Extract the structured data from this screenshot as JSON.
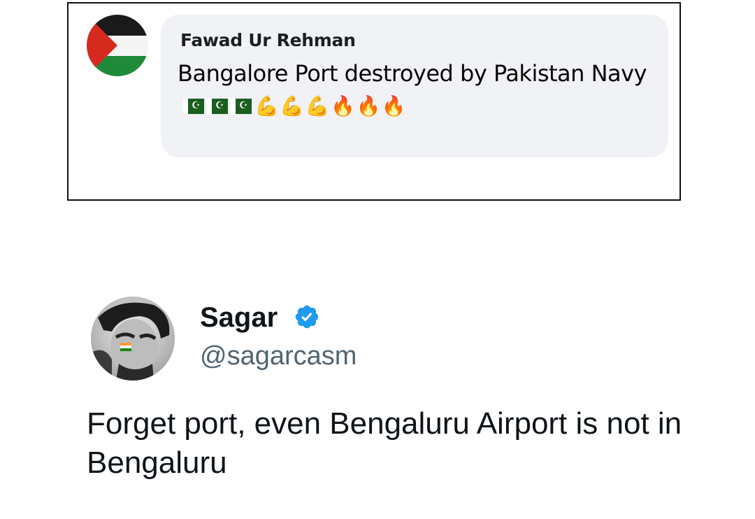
{
  "quoted_post": {
    "author_name": "Fawad Ur Rehman",
    "text": "Bangalore Port destroyed by Pakistan Navy",
    "emoji": [
      "pakistan-flag",
      "pakistan-flag",
      "pakistan-flag",
      "flexed-biceps",
      "flexed-biceps",
      "flexed-biceps",
      "fire",
      "fire",
      "fire"
    ]
  },
  "tweet": {
    "display_name": "Sagar",
    "handle": "@sagarcasm",
    "verified": true,
    "text": "Forget port, even Bengaluru Airport is not in Bengaluru"
  },
  "colors": {
    "bubble_bg": "#f0f2f5",
    "verified_blue": "#1d9bf0",
    "handle_gray": "#536471"
  }
}
